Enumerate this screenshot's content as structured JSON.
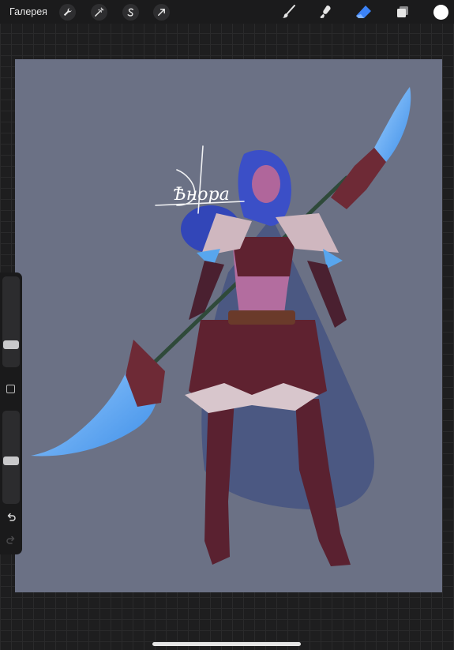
{
  "topbar": {
    "gallery_label": "Галерея",
    "left_tools": [
      "wrench-icon",
      "magic-wand-icon",
      "selection-icon",
      "transform-arrow-icon"
    ],
    "right_tools": [
      "brush-icon",
      "smudge-icon",
      "eraser-icon",
      "layers-icon",
      "color-swatch"
    ],
    "active_tool": "eraser-icon",
    "accent_color": "#3b82f6",
    "current_color": "#ffffff"
  },
  "canvas": {
    "background_color": "#6b7185",
    "signature_text": "Ѣнора"
  },
  "sidebar": {
    "brush_size_fraction": 0.22,
    "opacity_fraction": 0.46,
    "undo_icon": "undo-icon",
    "redo_icon": "redo-icon"
  }
}
